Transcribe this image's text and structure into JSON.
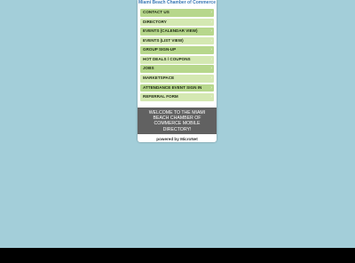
{
  "header": {
    "title": "Miami Beach Chamber of Commerce"
  },
  "menu": {
    "items": [
      {
        "label": "CONTACT US",
        "icon": "chevron-right-icon"
      },
      {
        "label": "DIRECTORY",
        "icon": "chevron-right-icon"
      },
      {
        "label": "EVENTS (CALENDAR VIEW)",
        "icon": "chevron-right-icon"
      },
      {
        "label": "EVENTS (LIST VIEW)",
        "icon": "chevron-right-icon"
      },
      {
        "label": "GROUP SIGN-UP",
        "icon": "chevron-right-icon"
      },
      {
        "label": "HOT DEALS / COUPONS",
        "icon": "chevron-right-icon"
      },
      {
        "label": "JOBS",
        "icon": "chevron-right-icon"
      },
      {
        "label": "MARKETSPACE",
        "icon": "chevron-right-icon"
      },
      {
        "label": "ATTENDANCE EVENT SIGN IN",
        "icon": "chevron-right-icon"
      },
      {
        "label": "REFERRAL FORM",
        "icon": "chevron-right-icon"
      }
    ]
  },
  "welcome": {
    "text": "WELCOME TO THE MIAMI BEACH CHAMBER OF COMMERCE MOBILE DIRECTORY!"
  },
  "footer": {
    "powered_by": "powered by MicroNet"
  },
  "colors": {
    "page_background": "#a3ced9",
    "title_text": "#3a78b5",
    "menu_item_dark": "#b7d78c",
    "menu_item_light": "#d4e8b2",
    "welcome_background": "#616161",
    "bottom_bar": "#000000"
  }
}
